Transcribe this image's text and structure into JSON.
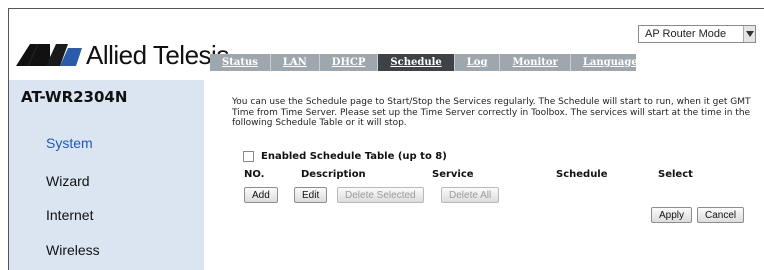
{
  "header": {
    "brand_name": "Allied Telesis",
    "mode_select": {
      "selected": "AP Router Mode"
    }
  },
  "tabs": [
    {
      "label": "Status",
      "active": false
    },
    {
      "label": "LAN",
      "active": false
    },
    {
      "label": "DHCP",
      "active": false
    },
    {
      "label": "Schedule",
      "active": true
    },
    {
      "label": "Log",
      "active": false
    },
    {
      "label": "Monitor",
      "active": false
    },
    {
      "label": "Language",
      "active": false
    }
  ],
  "sidebar": {
    "model": "AT-WR2304N",
    "items": [
      {
        "label": "System",
        "active": true
      },
      {
        "label": "Wizard",
        "active": false
      },
      {
        "label": "Internet",
        "active": false
      },
      {
        "label": "Wireless",
        "active": false
      }
    ]
  },
  "main": {
    "intro": "You can use the Schedule page to Start/Stop the Services regularly. The Schedule will start to run, when it get GMT Time from Time Server. Please set up the Time Server correctly in Toolbox. The services will start at the time in the following Schedule Table or it will stop.",
    "enable_label": "Enabled Schedule Table (up to 8)",
    "enable_checked": false,
    "columns": [
      "NO.",
      "Description",
      "Service",
      "Schedule",
      "Select"
    ],
    "buttons": {
      "add": "Add",
      "edit": "Edit",
      "delete_selected": "Delete Selected",
      "delete_all": "Delete All",
      "apply": "Apply",
      "cancel": "Cancel"
    }
  },
  "colors": {
    "tab_bar": "#9ea7ae",
    "tab_active": "#3e4246",
    "sidebar_bg": "#dbe5f1",
    "sidebar_active_text": "#1f58b3"
  }
}
